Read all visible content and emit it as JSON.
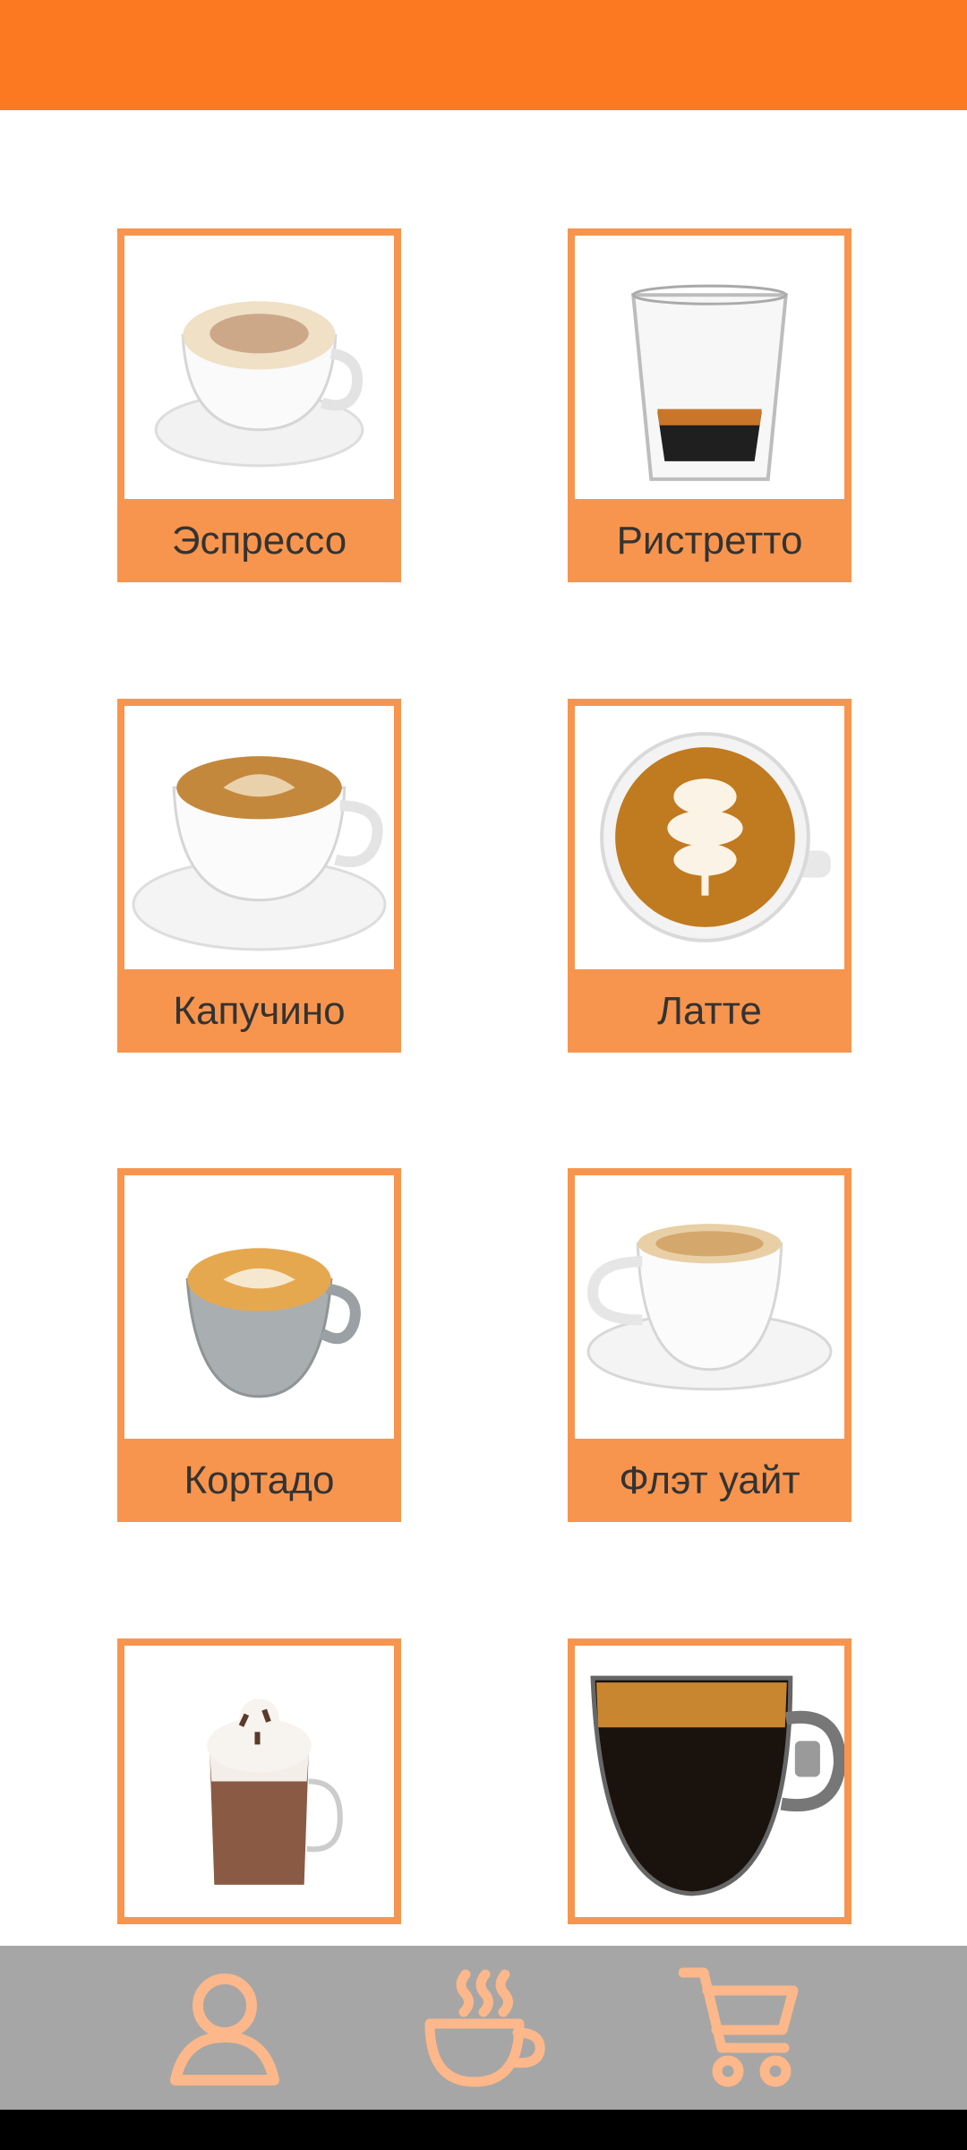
{
  "colors": {
    "accent": "#FD7921",
    "card": "#F7954E",
    "nav_bar": "#A6A6A6",
    "nav_icon": "#FCB88A"
  },
  "drinks": [
    {
      "label": "Эспрессо",
      "image": "cappuccino-cup-image"
    },
    {
      "label": "Ристретто",
      "image": "ristretto-glass-image"
    },
    {
      "label": "Капучино",
      "image": "cappuccino-latte-art-image"
    },
    {
      "label": "Латте",
      "image": "latte-art-top-view-image"
    },
    {
      "label": "Кортадо",
      "image": "cortado-cup-image"
    },
    {
      "label": "Флэт уайт",
      "image": "flat-white-cup-image"
    },
    {
      "label": "",
      "image": "hot-chocolate-mug-image"
    },
    {
      "label": "",
      "image": "espresso-glass-cup-image"
    }
  ],
  "bottom_nav": [
    "profile-icon",
    "coffee-cup-icon",
    "cart-icon"
  ]
}
